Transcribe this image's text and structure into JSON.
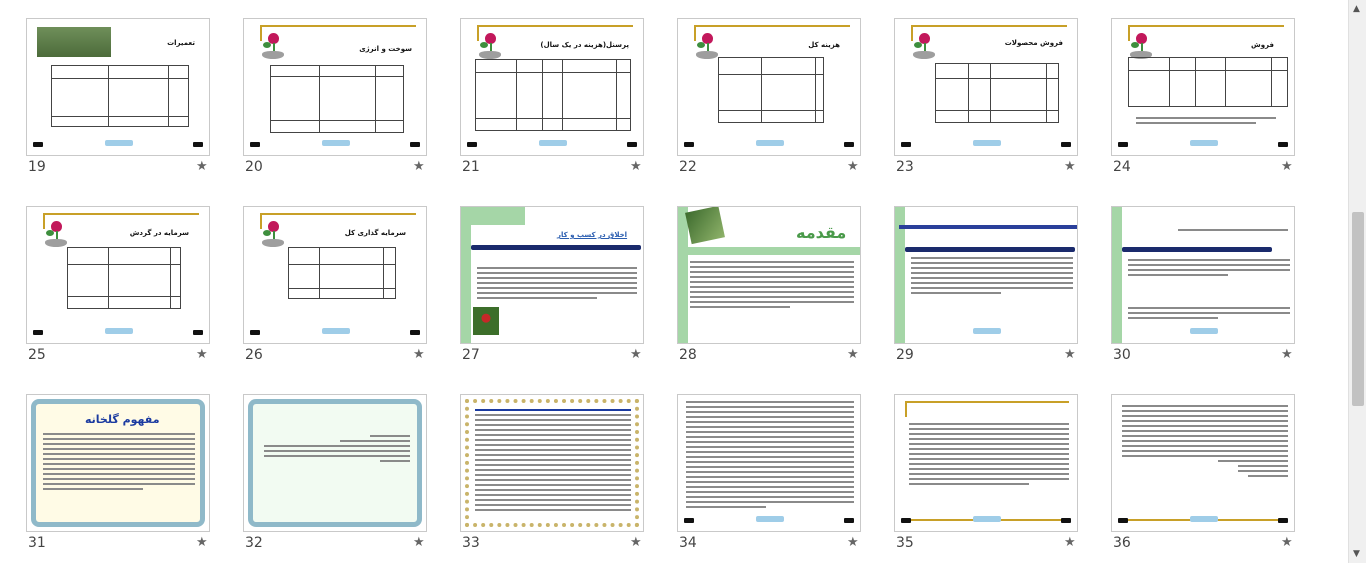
{
  "slides": [
    {
      "number": "19",
      "title": "تعمیرات"
    },
    {
      "number": "20",
      "title": "سوخت و انرژی"
    },
    {
      "number": "21",
      "title": "پرسنل(هزینه در یک سال)"
    },
    {
      "number": "22",
      "title": "هزینه کل"
    },
    {
      "number": "23",
      "title": "فروش محصولات"
    },
    {
      "number": "24",
      "title": "فروش"
    },
    {
      "number": "25",
      "title": "سرمایه در گردش"
    },
    {
      "number": "26",
      "title": "سرمایه گذاری کل"
    },
    {
      "number": "27",
      "title": "اخلاق در کسب و کار"
    },
    {
      "number": "28",
      "title": "مقدمه"
    },
    {
      "number": "29",
      "title": ""
    },
    {
      "number": "30",
      "title": ""
    },
    {
      "number": "31",
      "title": "مفهوم گلخانه"
    },
    {
      "number": "32",
      "title": ""
    },
    {
      "number": "33",
      "title": ""
    },
    {
      "number": "34",
      "title": ""
    },
    {
      "number": "35",
      "title": ""
    },
    {
      "number": "36",
      "title": ""
    }
  ],
  "icons": {
    "star": "star-icon",
    "scroll_up": "arrow-up-icon",
    "scroll_down": "arrow-down-icon"
  },
  "colors": {
    "accent_gold": "#c8a028",
    "rose": "#c2185b",
    "navy": "#1a2a6c",
    "green": "#a5d6a7"
  }
}
